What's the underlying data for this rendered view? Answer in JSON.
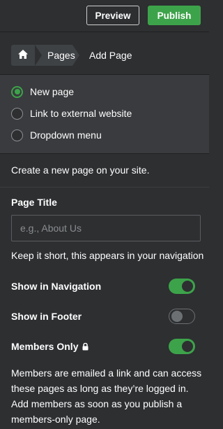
{
  "toolbar": {
    "preview_label": "Preview",
    "publish_label": "Publish"
  },
  "breadcrumb": {
    "home_icon": "home-icon",
    "pages_label": "Pages",
    "current_label": "Add Page"
  },
  "page_type": {
    "options": [
      {
        "label": "New page",
        "selected": true
      },
      {
        "label": "Link to external website",
        "selected": false
      },
      {
        "label": "Dropdown menu",
        "selected": false
      }
    ]
  },
  "description": "Create a new page on your site.",
  "page_title": {
    "label": "Page Title",
    "value": "",
    "placeholder": "e.g., About Us",
    "hint": "Keep it short, this appears in your navigation"
  },
  "toggles": {
    "show_in_navigation": {
      "label": "Show in Navigation",
      "on": true
    },
    "show_in_footer": {
      "label": "Show in Footer",
      "on": false
    },
    "members_only": {
      "label": "Members Only",
      "on": true,
      "icon": "lock-icon"
    }
  },
  "members_note": "Members are emailed a link and can access these pages as long as they’re logged in. Add members as soon as you publish a members-only page.",
  "colors": {
    "background": "#2d2f31",
    "band": "#393b3e",
    "accent_green": "#3da34a"
  }
}
